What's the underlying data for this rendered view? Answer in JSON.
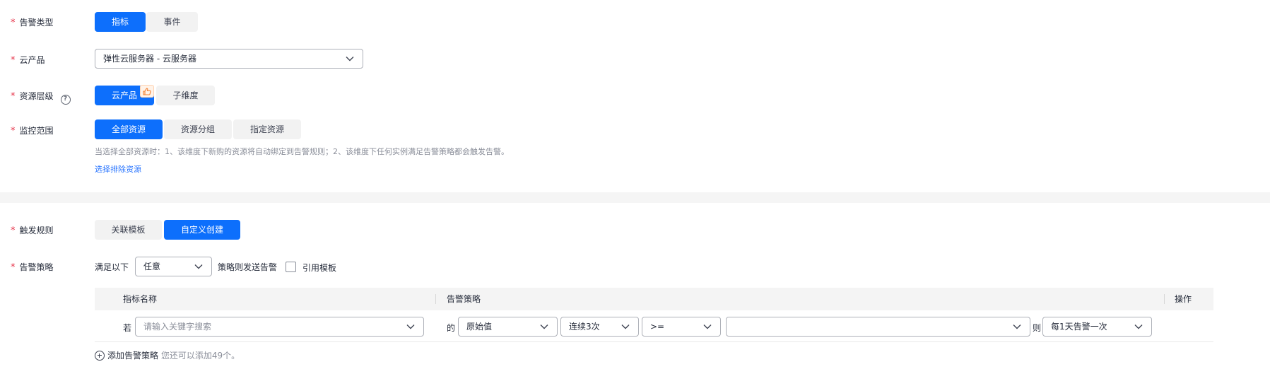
{
  "form": {
    "alarm_type": {
      "label": "告警类型",
      "options": [
        "指标",
        "事件"
      ],
      "selected": "指标"
    },
    "cloud_product": {
      "label": "云产品",
      "value": "弹性云服务器 - 云服务器"
    },
    "resource_level": {
      "label": "资源层级",
      "help_icon": "question-circle-icon",
      "options": [
        "云产品",
        "子维度"
      ],
      "selected": "云产品",
      "badge_icon": "thumbs-up-icon"
    },
    "monitor_scope": {
      "label": "监控范围",
      "options": [
        "全部资源",
        "资源分组",
        "指定资源"
      ],
      "selected": "全部资源",
      "hint": "当选择全部资源时：1、该维度下新购的资源将自动绑定到告警规则；2、该维度下任何实例满足告警策略都会触发告警。",
      "exclude_link": "选择排除资源"
    },
    "trigger_rule": {
      "label": "触发规则",
      "options": [
        "关联模板",
        "自定义创建"
      ],
      "selected": "自定义创建"
    },
    "alarm_policy": {
      "label": "告警策略",
      "prefix": "满足以下",
      "condition_value": "任意",
      "suffix": "策略则发送告警",
      "use_template_label": "引用模板",
      "use_template_checked": false,
      "table": {
        "columns": [
          "指标名称",
          "告警策略",
          "操作"
        ],
        "row": {
          "if_label": "若",
          "metric_placeholder": "请输入关键字搜索",
          "of_label": "的",
          "value_type": "原始值",
          "consecutive": "连续3次",
          "operator": ">=",
          "threshold": "",
          "then_label": "则",
          "frequency": "每1天告警一次"
        }
      },
      "add_label": "添加告警策略",
      "add_hint": "您还可以添加49个。"
    }
  },
  "colors": {
    "primary": "#0d6ffc",
    "required_star": "#e6354b",
    "link": "#2673ff",
    "muted_text": "#8a8e99"
  }
}
